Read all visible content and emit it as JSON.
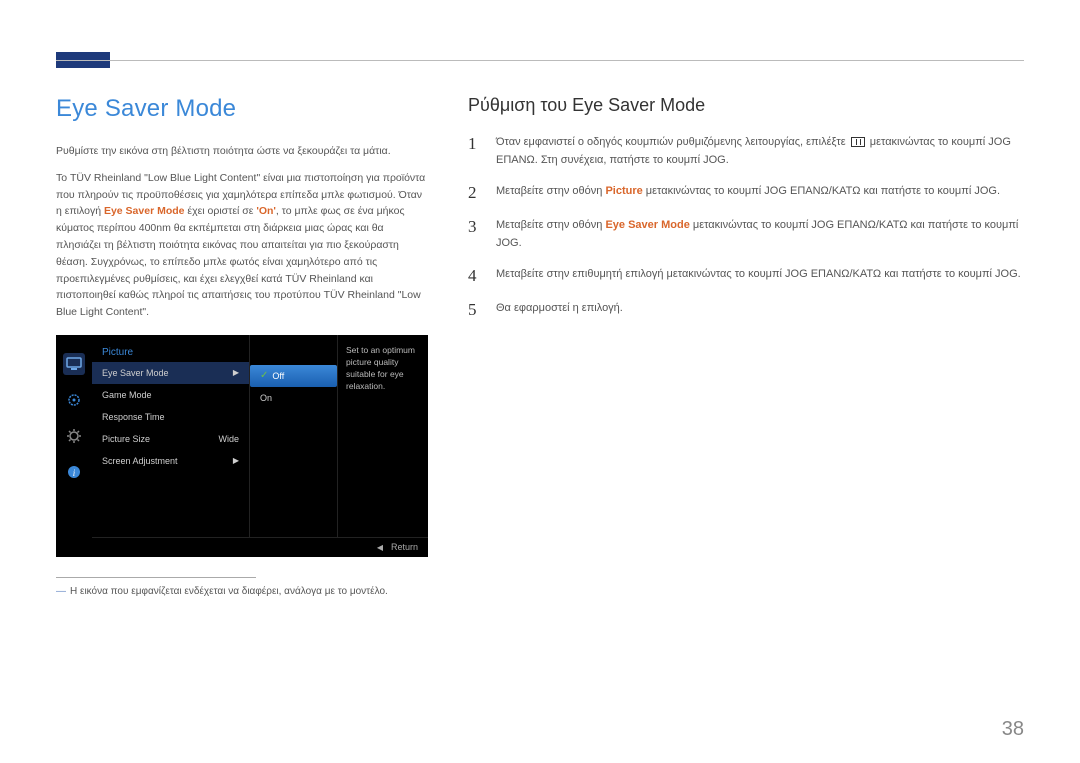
{
  "header": {
    "title": "Eye Saver Mode",
    "subtitle": "Ρύθμιση του Eye Saver Mode"
  },
  "left": {
    "intro": "Ρυθμίστε την εικόνα στη βέλτιστη ποιότητα ώστε να ξεκουράζει τα μάτια.",
    "desc_pre": "Το TÜV Rheinland \"Low Blue Light Content\" είναι μια πιστοποίηση για προϊόντα που πληρούν τις προϋποθέσεις για χαμηλότερα επίπεδα μπλε φωτισμού. Όταν η επιλογή ",
    "desc_mode": "Eye Saver Mode",
    "desc_mid": " έχει οριστεί σε ",
    "desc_on": "'On'",
    "desc_post": ", το μπλε φως σε ένα μήκος κύματος περίπου 400nm θα εκπέμπεται στη διάρκεια μιας ώρας και θα πλησιάζει τη βέλτιστη ποιότητα εικόνας που απαιτείται για πιο ξεκούραστη θέαση. Συγχρόνως, το επίπεδο μπλε φωτός είναι χαμηλότερο από τις προεπιλεγμένες ρυθμίσεις, και έχει ελεγχθεί κατά TÜV Rheinland και πιστοποιηθεί καθώς πληροί τις απαιτήσεις του προτύπου TÜV Rheinland \"Low Blue Light Content\"."
  },
  "osd": {
    "menu_header": "Picture",
    "items": {
      "eye": "Eye Saver Mode",
      "game": "Game Mode",
      "response": "Response Time",
      "picsize": "Picture Size",
      "picsize_val": "Wide",
      "screen": "Screen Adjustment"
    },
    "options": {
      "off": "Off",
      "on": "On"
    },
    "help": "Set to an optimum picture quality suitable for eye relaxation.",
    "footer_return": "Return"
  },
  "footnote": "Η εικόνα που εμφανίζεται ενδέχεται να διαφέρει, ανάλογα με το μοντέλο.",
  "steps": {
    "s1a": "Όταν εμφανιστεί ο οδηγός κουμπιών ρυθμιζόμενης λειτουργίας, επιλέξτε ",
    "s1b": " μετακινώντας το κουμπί JOG ΕΠΑΝΩ. Στη συνέχεια, πατήστε το κουμπί JOG.",
    "s2a": "Μεταβείτε στην οθόνη ",
    "s2_pic": "Picture",
    "s2b": " μετακινώντας το κουμπί JOG ΕΠΑΝΩ/ΚΑΤΩ και πατήστε το κουμπί JOG.",
    "s3a": "Μεταβείτε στην οθόνη ",
    "s3_esm": "Eye Saver Mode",
    "s3b": " μετακινώντας το κουμπί JOG ΕΠΑΝΩ/ΚΑΤΩ και πατήστε το κουμπί JOG.",
    "s4": "Μεταβείτε στην επιθυμητή επιλογή μετακινώντας το κουμπί JOG ΕΠΑΝΩ/ΚΑΤΩ και πατήστε το κουμπί JOG.",
    "s5": "Θα εφαρμοστεί η επιλογή."
  },
  "page_number": "38"
}
